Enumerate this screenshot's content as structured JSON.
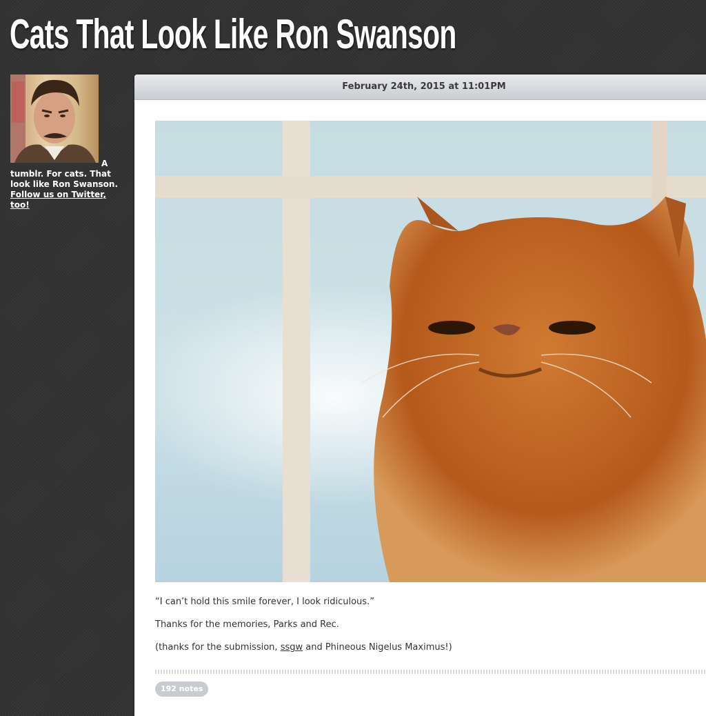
{
  "site": {
    "title": "Cats That Look Like Ron Swanson"
  },
  "sidebar": {
    "description": "A tumblr. For cats. That look like Ron Swanson.",
    "twitter_link": "Follow us on Twitter, too!"
  },
  "post": {
    "date": "February 24th, 2015 at 11:01PM",
    "caption": {
      "quote": "“I can’t hold this smile forever, I look ridiculous.”",
      "thanks": "Thanks for the memories, Parks and Rec.",
      "credit_prefix": "(thanks for the submission, ",
      "credit_link": "ssgw",
      "credit_suffix": " and Phineous Nigelus Maximus!)"
    },
    "notes": "192 notes"
  },
  "colors": {
    "background": "#333333",
    "header_gradient_top": "#e9eaec",
    "header_gradient_bottom": "#c9ccd1",
    "notes_badge": "#c8ccd1",
    "cat_fur": "#c4661d"
  }
}
